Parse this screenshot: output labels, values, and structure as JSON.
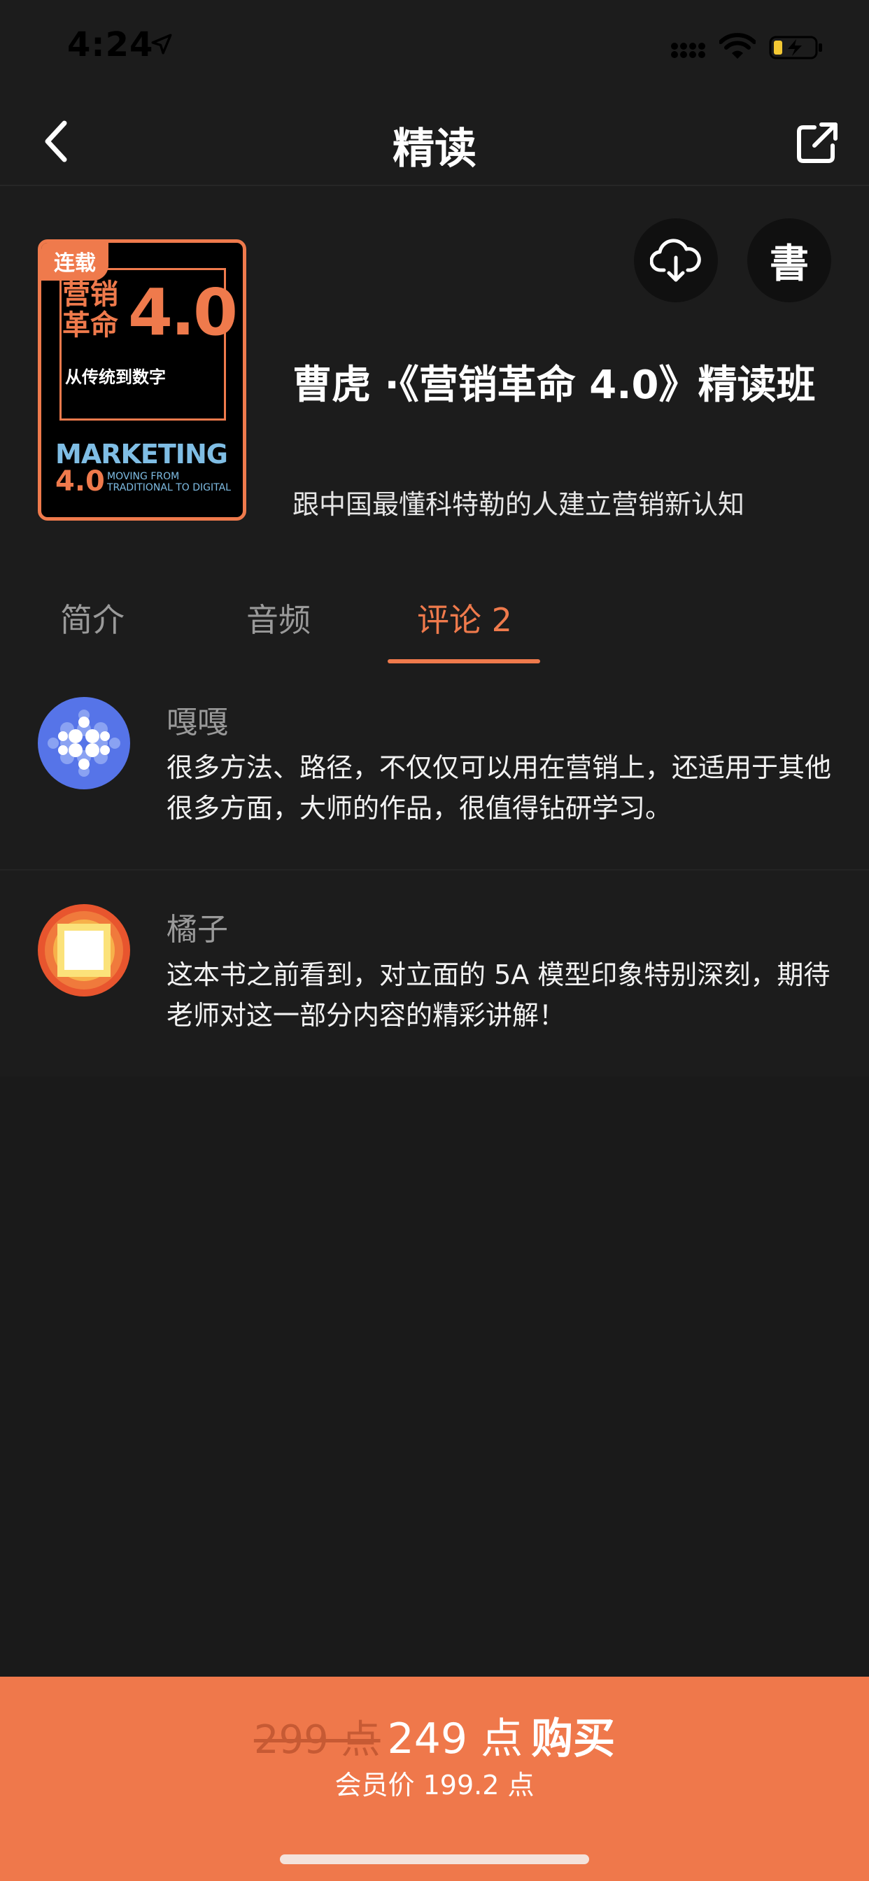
{
  "status_bar": {
    "time": "4:24"
  },
  "nav": {
    "title": "精读"
  },
  "book": {
    "badge": "连载",
    "cover_title_cn": "营销 革命",
    "cover_title_num": "4.0",
    "cover_subtitle": "从传统到数字",
    "cover_en_title": "MARKETING",
    "cover_en_num": "4.0",
    "cover_en_sub": "MOVING FROM TRADITIONAL TO DIGITAL"
  },
  "actions": {
    "book_glyph": "書"
  },
  "course": {
    "title": "曹虎 ·《营销革命 4.0》精读班",
    "subtitle": "跟中国最懂科特勒的人建立营销新认知"
  },
  "tabs": [
    {
      "label": "简介"
    },
    {
      "label": "音频"
    },
    {
      "label": "评论 2"
    }
  ],
  "comments": [
    {
      "user": "嘎嘎",
      "text": "很多方法、路径，不仅仅可以用在营销上，还适用于其他很多方面，大师的作品，很值得钻研学习。"
    },
    {
      "user": "橘子",
      "text": "这本书之前看到，对立面的 5A 模型印象特别深刻，期待老师对这一部分内容的精彩讲解！"
    }
  ],
  "purchase": {
    "original_price": "299 点",
    "price": "249 点",
    "buy_label": "购买",
    "member_price": "会员价 199.2 点"
  },
  "colors": {
    "accent": "#ef7a4c",
    "background": "#1c1c1c",
    "buy_bar": "#ef784b"
  }
}
